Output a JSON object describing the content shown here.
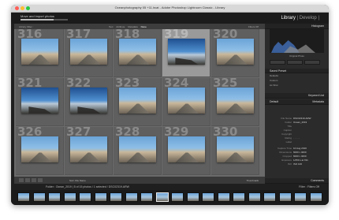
{
  "window": {
    "title": "Oceanphotography 05 +11.lrcat - Adobe Photoshop Lightroom Classic - Library"
  },
  "identity": {
    "label": "Move and import photos"
  },
  "modules": {
    "library": "Library",
    "sep": "|",
    "develop": "Develop",
    "sep2": "|"
  },
  "filter_bar": {
    "label": "Library Filter :",
    "tabs": [
      "Text",
      "Attribute",
      "Metadata",
      "None"
    ],
    "filter_off": "Filters Off"
  },
  "grid": {
    "numbers": [
      "316",
      "317",
      "318",
      "319",
      "320",
      "321",
      "322",
      "323",
      "324",
      "325",
      "326",
      "327",
      "328",
      "329",
      "330"
    ],
    "selected_index": 3
  },
  "toolbar": {
    "sort_label": "Sort: File Name",
    "thumbnails_label": "Thumbnails"
  },
  "right_panel": {
    "histogram_label": "Histogram",
    "original_photo": "Original Photo",
    "quick_develop_label": "Saved Preset",
    "quick_dev_rows": [
      "Defaults",
      "Custom",
      "As Shot"
    ],
    "keywording_label": "Keyword List",
    "metadata_label": "Metadata",
    "metadata_default": "Default",
    "meta_labels": [
      "File Name",
      "Folder",
      "Title",
      "Caption",
      "Copyright",
      "Rating",
      "Label",
      "Capture Time",
      "Dimensions",
      "Cropped",
      "Exposure",
      "ISO"
    ],
    "meta_values": [
      "DSC02319.ARW",
      "Ocean_2019",
      "",
      "",
      "",
      "· · · · ·",
      "",
      "10 Aug 2019",
      "6000 x 4000",
      "6000 x 4000",
      "1/250 s at f/11",
      "ISO 100"
    ],
    "comments_label": "Comments"
  },
  "filmstrip": {
    "source": "Folder : Ocean_2019 | 5 of 15 photos / 1 selected / DSC02319.ARW",
    "filter_label": "Filter :",
    "filter_value": "Filters Off"
  },
  "colors": {
    "accent": "#6aa3d8",
    "panel": "#2b2b2b",
    "grid_bg": "#6a6a6a"
  }
}
